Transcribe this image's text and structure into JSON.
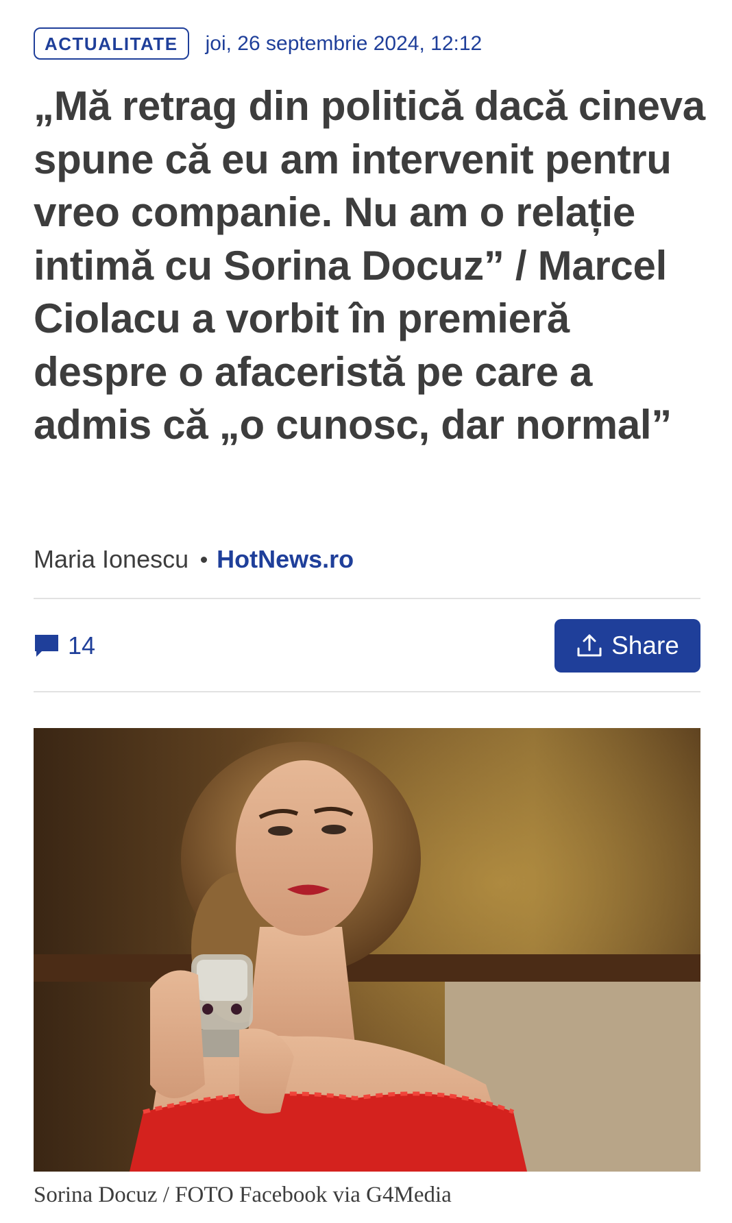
{
  "article": {
    "category": "ACTUALITATE",
    "date": "joi, 26 septembrie 2024, 12:12",
    "headline": "„Mă retrag din politică dacă cineva spune că eu am intervenit pentru vreo companie. Nu am o relație intimă cu Sorina Docuz” / Marcel Ciolacu a vorbit în premieră despre o afaceristă pe care a admis că „o cunosc, dar normal”",
    "author": "Maria Ionescu",
    "source": "HotNews.ro"
  },
  "actions": {
    "comments_count": "14",
    "share_label": "Share",
    "comment_icon": "speech-bubble-icon",
    "share_icon": "upload-arrow-icon"
  },
  "image": {
    "caption": "Sorina Docuz / FOTO Facebook via G4Media"
  },
  "colors": {
    "accent": "#1f3f9a",
    "text": "#3d3d3d",
    "divider": "#e2e2e2",
    "background": "#ffffff"
  }
}
